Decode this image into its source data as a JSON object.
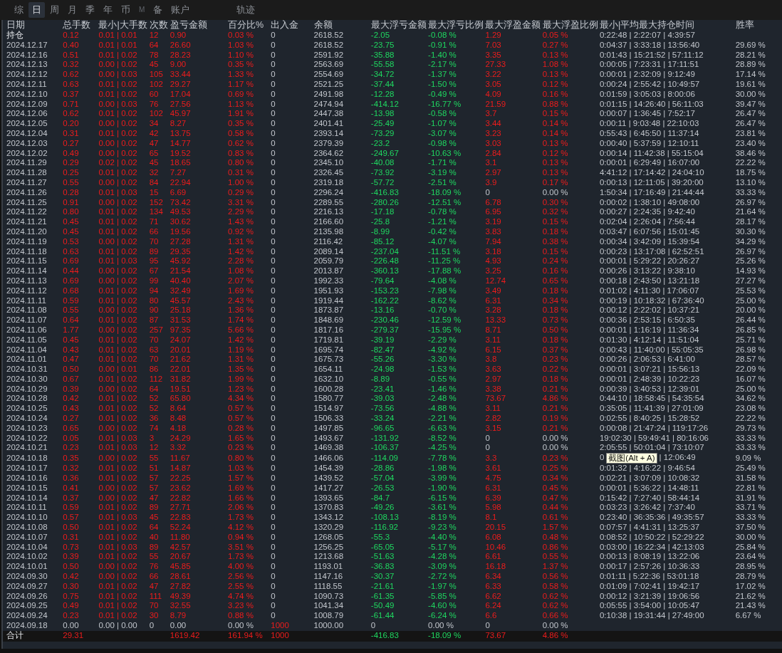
{
  "tabs": [
    {
      "label": "综",
      "selected": false,
      "kind": "normal"
    },
    {
      "label": "日",
      "selected": true,
      "kind": "normal"
    },
    {
      "label": "周",
      "selected": false,
      "kind": "normal"
    },
    {
      "label": "月",
      "selected": false,
      "kind": "normal"
    },
    {
      "label": "季",
      "selected": false,
      "kind": "normal"
    },
    {
      "label": "年",
      "selected": false,
      "kind": "normal"
    },
    {
      "label": "币",
      "selected": false,
      "kind": "normal"
    },
    {
      "label": "M",
      "selected": false,
      "kind": "dim"
    },
    {
      "label": "备",
      "selected": false,
      "kind": "normal"
    },
    {
      "label": "账户",
      "selected": false,
      "kind": "normal"
    },
    {
      "label": "轨迹",
      "selected": false,
      "kind": "far"
    }
  ],
  "table": {
    "columns": [
      "日期",
      "总手数",
      "最小|大手数",
      "次数",
      "盈亏金额",
      "百分比%",
      "出入金",
      "余额",
      "最大浮亏金额",
      "最大浮亏比例",
      "最大浮盈金额",
      "最大浮盈比例",
      "最小|平均最大持仓时间",
      "胜率"
    ],
    "rows": [
      {
        "kind": "position",
        "cells": [
          "持仓",
          "0.12",
          "0.01 | 0.01",
          "12",
          "0.90",
          "0.03 %",
          "0",
          "2618.52",
          "-2.05",
          "-0.08 %",
          "1.29",
          "0.05 %",
          "0:22:48 | 2:22:07 | 4:39:57"
        ]
      },
      {
        "kind": "day",
        "cells": [
          "2024.12.17",
          "0.40",
          "0.01 | 0.01",
          "64",
          "26.60",
          "1.03 %",
          "0",
          "2618.52",
          "-23.75",
          "-0.91 %",
          "7.03",
          "0.27 %",
          "0:04:37 | 3:33:18 | 13:56:40",
          "29.69 %"
        ]
      },
      {
        "kind": "day",
        "cells": [
          "2024.12.16",
          "0.51",
          "0.01 | 0.02",
          "78",
          "28.23",
          "1.10 %",
          "0",
          "2591.92",
          "-35.88",
          "-1.40 %",
          "3.35",
          "0.13 %",
          "0:01:43 | 15:21:52 | 57:11:12",
          "28.21 %"
        ]
      },
      {
        "kind": "day",
        "cells": [
          "2024.12.13",
          "0.32",
          "0.00 | 0.02",
          "45",
          "9.00",
          "0.35 %",
          "0",
          "2563.69",
          "-55.58",
          "-2.17 %",
          "27.33",
          "1.08 %",
          "0:00:05 | 7:23:31 | 17:11:51",
          "28.89 %"
        ]
      },
      {
        "kind": "day",
        "cells": [
          "2024.12.12",
          "0.62",
          "0.00 | 0.03",
          "105",
          "33.44",
          "1.33 %",
          "0",
          "2554.69",
          "-34.72",
          "-1.37 %",
          "3.22",
          "0.13 %",
          "0:00:01 | 2:32:09 | 9:12:49",
          "17.14 %"
        ]
      },
      {
        "kind": "day",
        "cells": [
          "2024.12.11",
          "0.63",
          "0.01 | 0.02",
          "102",
          "29.27",
          "1.17 %",
          "0",
          "2521.25",
          "-37.44",
          "-1.50 %",
          "3.05",
          "0.12 %",
          "0:00:24 | 2:55:42 | 10:49:57",
          "19.61 %"
        ]
      },
      {
        "kind": "day",
        "cells": [
          "2024.12.10",
          "0.37",
          "0.01 | 0.02",
          "60",
          "17.04",
          "0.69 %",
          "0",
          "2491.98",
          "-12.28",
          "-0.49 %",
          "4.09",
          "0.16 %",
          "0:01:59 | 3:05:03 | 8:00:06",
          "30.00 %"
        ]
      },
      {
        "kind": "day",
        "cells": [
          "2024.12.09",
          "0.71",
          "0.00 | 0.03",
          "76",
          "27.56",
          "1.13 %",
          "0",
          "2474.94",
          "-414.12",
          "-16.77 %",
          "21.59",
          "0.88 %",
          "0:01:15 | 14:26:40 | 56:11:03",
          "39.47 %"
        ]
      },
      {
        "kind": "day",
        "cells": [
          "2024.12.06",
          "0.62",
          "0.01 | 0.02",
          "102",
          "45.97",
          "1.91 %",
          "0",
          "2447.38",
          "-13.98",
          "-0.58 %",
          "3.7",
          "0.15 %",
          "0:00:07 | 1:36:45 | 7:52:17",
          "26.47 %"
        ]
      },
      {
        "kind": "day",
        "cells": [
          "2024.12.05",
          "0.20",
          "0.00 | 0.02",
          "34",
          "8.27",
          "0.35 %",
          "0",
          "2401.41",
          "-25.49",
          "-1.07 %",
          "3.44",
          "0.14 %",
          "0:00:11 | 9:03:48 | 22:10:03",
          "26.47 %"
        ]
      },
      {
        "kind": "day",
        "cells": [
          "2024.12.04",
          "0.31",
          "0.01 | 0.02",
          "42",
          "13.75",
          "0.58 %",
          "0",
          "2393.14",
          "-73.29",
          "-3.07 %",
          "3.23",
          "0.14 %",
          "0:55:43 | 6:45:50 | 11:37:14",
          "23.81 %"
        ]
      },
      {
        "kind": "day",
        "cells": [
          "2024.12.03",
          "0.27",
          "0.00 | 0.02",
          "47",
          "14.77",
          "0.62 %",
          "0",
          "2379.39",
          "-23.2",
          "-0.98 %",
          "3.03",
          "0.13 %",
          "0:00:40 | 5:37:59 | 12:10:11",
          "23.40 %"
        ]
      },
      {
        "kind": "day",
        "cells": [
          "2024.12.02",
          "0.49",
          "0.00 | 0.02",
          "65",
          "19.52",
          "0.83 %",
          "0",
          "2364.62",
          "-249.67",
          "-10.63 %",
          "2.84",
          "0.12 %",
          "0:00:14 | 11:42:38 | 55:15:04",
          "38.46 %"
        ]
      },
      {
        "kind": "day",
        "cells": [
          "2024.11.29",
          "0.29",
          "0.02 | 0.02",
          "45",
          "18.65",
          "0.80 %",
          "0",
          "2345.10",
          "-40.08",
          "-1.71 %",
          "3.1",
          "0.13 %",
          "0:00:01 | 6:29:49 | 16:07:00",
          "22.22 %"
        ]
      },
      {
        "kind": "day",
        "cells": [
          "2024.11.28",
          "0.25",
          "0.01 | 0.02",
          "32",
          "7.27",
          "0.31 %",
          "0",
          "2326.45",
          "-73.92",
          "-3.19 %",
          "2.97",
          "0.13 %",
          "4:41:12 | 17:14:42 | 24:04:10",
          "18.75 %"
        ]
      },
      {
        "kind": "day",
        "cells": [
          "2024.11.27",
          "0.55",
          "0.00 | 0.02",
          "84",
          "22.94",
          "1.00 %",
          "0",
          "2319.18",
          "-57.72",
          "-2.51 %",
          "3.9",
          "0.17 %",
          "0:00:13 | 12:11:05 | 39:20:00",
          "13.10 %"
        ]
      },
      {
        "kind": "flat_day",
        "cells": [
          "2024.11.26",
          "0.28",
          "0.01 | 0.03",
          "15",
          "6.69",
          "0.29 %",
          "0",
          "2296.24",
          "-416.83",
          "-18.09 %",
          "0",
          "0.00 %",
          "1:50:34 | 17:16:49 | 21:44:44",
          "33.33 %"
        ]
      },
      {
        "kind": "day",
        "cells": [
          "2024.11.25",
          "0.91",
          "0.00 | 0.02",
          "152",
          "73.42",
          "3.31 %",
          "0",
          "2289.55",
          "-280.26",
          "-12.51 %",
          "6.78",
          "0.30 %",
          "0:00:02 | 1:38:10 | 49:08:00",
          "26.97 %"
        ]
      },
      {
        "kind": "day",
        "cells": [
          "2024.11.22",
          "0.80",
          "0.01 | 0.02",
          "134",
          "49.53",
          "2.29 %",
          "0",
          "2216.13",
          "-17.18",
          "-0.78 %",
          "6.95",
          "0.32 %",
          "0:00:27 | 2:24:35 | 9:42:40",
          "21.64 %"
        ]
      },
      {
        "kind": "day",
        "cells": [
          "2024.11.21",
          "0.45",
          "0.01 | 0.02",
          "71",
          "30.62",
          "1.43 %",
          "0",
          "2166.60",
          "-25.8",
          "-1.21 %",
          "3.19",
          "0.15 %",
          "0:02:04 | 2:26:04 | 7:56:44",
          "28.17 %"
        ]
      },
      {
        "kind": "day",
        "cells": [
          "2024.11.20",
          "0.45",
          "0.01 | 0.02",
          "66",
          "19.56",
          "0.92 %",
          "0",
          "2135.98",
          "-8.99",
          "-0.42 %",
          "3.83",
          "0.18 %",
          "0:03:47 | 6:07:56 | 15:01:45",
          "30.30 %"
        ]
      },
      {
        "kind": "day",
        "cells": [
          "2024.11.19",
          "0.53",
          "0.00 | 0.02",
          "70",
          "27.28",
          "1.31 %",
          "0",
          "2116.42",
          "-85.12",
          "-4.07 %",
          "7.94",
          "0.38 %",
          "0:00:34 | 3:42:09 | 15:39:54",
          "34.29 %"
        ]
      },
      {
        "kind": "day",
        "cells": [
          "2024.11.18",
          "0.63",
          "0.01 | 0.02",
          "89",
          "29.35",
          "1.42 %",
          "0",
          "2089.14",
          "-237.04",
          "-11.51 %",
          "3.18",
          "0.15 %",
          "0:00:23 | 13:17:08 | 62:52:51",
          "26.97 %"
        ]
      },
      {
        "kind": "day",
        "cells": [
          "2024.11.15",
          "0.69",
          "0.01 | 0.03",
          "95",
          "45.92",
          "2.28 %",
          "0",
          "2059.79",
          "-226.48",
          "-11.25 %",
          "4.93",
          "0.24 %",
          "0:00:01 | 5:29:22 | 20:26:27",
          "25.26 %"
        ]
      },
      {
        "kind": "day",
        "cells": [
          "2024.11.14",
          "0.44",
          "0.00 | 0.02",
          "67",
          "21.54",
          "1.08 %",
          "0",
          "2013.87",
          "-360.13",
          "-17.88 %",
          "3.25",
          "0.16 %",
          "0:00:26 | 3:13:22 | 9:38:10",
          "14.93 %"
        ]
      },
      {
        "kind": "day",
        "cells": [
          "2024.11.13",
          "0.69",
          "0.00 | 0.02",
          "99",
          "40.40",
          "2.07 %",
          "0",
          "1992.33",
          "-79.64",
          "-4.08 %",
          "12.74",
          "0.65 %",
          "0:00:18 | 2:43:50 | 13:21:18",
          "27.27 %"
        ]
      },
      {
        "kind": "day",
        "cells": [
          "2024.11.12",
          "0.68",
          "0.01 | 0.02",
          "94",
          "32.49",
          "1.69 %",
          "0",
          "1951.93",
          "-153.23",
          "-7.98 %",
          "3.49",
          "0.18 %",
          "0:01:02 | 4:11:30 | 17:06:07",
          "25.53 %"
        ]
      },
      {
        "kind": "day",
        "cells": [
          "2024.11.11",
          "0.59",
          "0.01 | 0.02",
          "80",
          "45.57",
          "2.43 %",
          "0",
          "1919.44",
          "-162.22",
          "-8.62 %",
          "6.31",
          "0.34 %",
          "0:00:19 | 10:18:32 | 67:36:40",
          "25.00 %"
        ]
      },
      {
        "kind": "day",
        "cells": [
          "2024.11.08",
          "0.55",
          "0.00 | 0.02",
          "90",
          "25.18",
          "1.36 %",
          "0",
          "1873.87",
          "-13.16",
          "-0.70 %",
          "3.28",
          "0.18 %",
          "0:00:12 | 2:22:02 | 10:37:21",
          "20.00 %"
        ]
      },
      {
        "kind": "day",
        "cells": [
          "2024.11.07",
          "0.64",
          "0.01 | 0.02",
          "87",
          "31.53",
          "1.74 %",
          "0",
          "1848.69",
          "-230.46",
          "-12.59 %",
          "13.33",
          "0.73 %",
          "0:00:36 | 2:53:15 | 6:50:35",
          "26.44 %"
        ]
      },
      {
        "kind": "day",
        "cells": [
          "2024.11.06",
          "1.77",
          "0.00 | 0.02",
          "257",
          "97.35",
          "5.66 %",
          "0",
          "1817.16",
          "-279.37",
          "-15.95 %",
          "8.71",
          "0.50 %",
          "0:00:01 | 1:16:19 | 11:36:34",
          "26.85 %"
        ]
      },
      {
        "kind": "day",
        "cells": [
          "2024.11.05",
          "0.45",
          "0.01 | 0.02",
          "70",
          "24.07",
          "1.42 %",
          "0",
          "1719.81",
          "-39.19",
          "-2.29 %",
          "3.11",
          "0.18 %",
          "0:01:30 | 4:12:14 | 11:51:04",
          "25.71 %"
        ]
      },
      {
        "kind": "day",
        "cells": [
          "2024.11.04",
          "0.43",
          "0.01 | 0.02",
          "63",
          "20.01",
          "1.19 %",
          "0",
          "1695.74",
          "-82.47",
          "-4.92 %",
          "6.15",
          "0.37 %",
          "0:00:43 | 11:40:00 | 55:05:35",
          "26.98 %"
        ]
      },
      {
        "kind": "day",
        "cells": [
          "2024.11.01",
          "0.47",
          "0.01 | 0.02",
          "70",
          "21.62",
          "1.31 %",
          "0",
          "1675.73",
          "-55.26",
          "-3.30 %",
          "3.8",
          "0.23 %",
          "0:00:26 | 2:06:53 | 6:41:00",
          "28.57 %"
        ]
      },
      {
        "kind": "day",
        "cells": [
          "2024.10.31",
          "0.50",
          "0.00 | 0.01",
          "86",
          "22.01",
          "1.35 %",
          "0",
          "1654.11",
          "-24.98",
          "-1.53 %",
          "3.63",
          "0.22 %",
          "0:00:01 | 3:07:21 | 15:56:13",
          "22.09 %"
        ]
      },
      {
        "kind": "day",
        "cells": [
          "2024.10.30",
          "0.67",
          "0.01 | 0.02",
          "112",
          "31.82",
          "1.99 %",
          "0",
          "1632.10",
          "-8.89",
          "-0.55 %",
          "2.97",
          "0.18 %",
          "0:00:01 | 2:48:39 | 10:22:23",
          "16.07 %"
        ]
      },
      {
        "kind": "day",
        "cells": [
          "2024.10.29",
          "0.39",
          "0.00 | 0.02",
          "64",
          "19.51",
          "1.23 %",
          "0",
          "1600.28",
          "-23.41",
          "-1.46 %",
          "3.38",
          "0.21 %",
          "0:00:39 | 3:40:53 | 12:39:01",
          "25.00 %"
        ]
      },
      {
        "kind": "day",
        "cells": [
          "2024.10.28",
          "0.42",
          "0.01 | 0.02",
          "52",
          "65.80",
          "4.34 %",
          "0",
          "1580.77",
          "-39.03",
          "-2.48 %",
          "73.67",
          "4.86 %",
          "0:44:10 | 18:58:45 | 54:35:54",
          "34.62 %"
        ]
      },
      {
        "kind": "day",
        "cells": [
          "2024.10.25",
          "0.43",
          "0.01 | 0.02",
          "52",
          "8.64",
          "0.57 %",
          "0",
          "1514.97",
          "-73.56",
          "-4.88 %",
          "3.11",
          "0.21 %",
          "0:35:05 | 11:41:39 | 27:01:09",
          "23.08 %"
        ]
      },
      {
        "kind": "day",
        "cells": [
          "2024.10.24",
          "0.27",
          "0.01 | 0.02",
          "36",
          "8.48",
          "0.57 %",
          "0",
          "1506.33",
          "-33.24",
          "-2.21 %",
          "2.82",
          "0.19 %",
          "0:02:55 | 8:40:25 | 15:28:52",
          "22.22 %"
        ]
      },
      {
        "kind": "day",
        "cells": [
          "2024.10.23",
          "0.65",
          "0.00 | 0.02",
          "74",
          "4.18",
          "0.28 %",
          "0",
          "1497.85",
          "-96.65",
          "-6.63 %",
          "3.15",
          "0.21 %",
          "0:00:08 | 21:47:24 | 119:17:26",
          "29.73 %"
        ]
      },
      {
        "kind": "flat_day",
        "cells": [
          "2024.10.22",
          "0.05",
          "0.01 | 0.03",
          "3",
          "24.29",
          "1.65 %",
          "0",
          "1493.67",
          "-131.92",
          "-8.52 %",
          "0",
          "0.00 %",
          "19:02:30 | 59:49:41 | 80:16:06",
          "33.33 %"
        ]
      },
      {
        "kind": "flat_day",
        "cells": [
          "2024.10.21",
          "0.23",
          "0.01 | 0.03",
          "12",
          "3.32",
          "0.23 %",
          "0",
          "1469.38",
          "-106.37",
          "-4.25 %",
          "0",
          "0.00 %",
          "2:05:55 | 50:01:04 | 73:10:07",
          "33.33 %"
        ]
      },
      {
        "kind": "day",
        "cells": [
          "2024.10.18",
          "0.35",
          "0.00 | 0.02",
          "55",
          "11.67",
          "0.80 %",
          "0",
          "1466.06",
          "-114.09",
          "-7.78 %",
          "3.3",
          "0.23 %",
          "0",
          "9.09 %"
        ],
        "tooltip": "截图(Alt + A)",
        "time_rest": "| 12:06:49"
      },
      {
        "kind": "day",
        "cells": [
          "2024.10.17",
          "0.32",
          "0.01 | 0.02",
          "51",
          "14.87",
          "1.03 %",
          "0",
          "1454.39",
          "-28.86",
          "-1.98 %",
          "3.61",
          "0.25 %",
          "0:01:32 | 4:16:22 | 9:46:54",
          "25.49 %"
        ]
      },
      {
        "kind": "day",
        "cells": [
          "2024.10.16",
          "0.36",
          "0.01 | 0.02",
          "57",
          "22.25",
          "1.57 %",
          "0",
          "1439.52",
          "-57.04",
          "-3.99 %",
          "4.75",
          "0.34 %",
          "0:02:21 | 3:07:09 | 10:08:32",
          "31.58 %"
        ]
      },
      {
        "kind": "day",
        "cells": [
          "2024.10.15",
          "0.41",
          "0.00 | 0.02",
          "57",
          "23.62",
          "1.69 %",
          "0",
          "1417.27",
          "-26.53",
          "-1.90 %",
          "6.31",
          "0.45 %",
          "0:00:01 | 5:36:22 | 14:48:11",
          "22.81 %"
        ]
      },
      {
        "kind": "day",
        "cells": [
          "2024.10.14",
          "0.37",
          "0.00 | 0.02",
          "47",
          "22.82",
          "1.66 %",
          "0",
          "1393.65",
          "-84.7",
          "-6.15 %",
          "6.39",
          "0.47 %",
          "0:15:42 | 7:27:40 | 58:44:14",
          "31.91 %"
        ]
      },
      {
        "kind": "day",
        "cells": [
          "2024.10.11",
          "0.59",
          "0.01 | 0.02",
          "89",
          "27.71",
          "2.06 %",
          "0",
          "1370.83",
          "-49.26",
          "-3.61 %",
          "5.98",
          "0.44 %",
          "0:03:23 | 3:26:42 | 7:37:40",
          "33.71 %"
        ]
      },
      {
        "kind": "day",
        "cells": [
          "2024.10.10",
          "0.57",
          "0.01 | 0.03",
          "45",
          "22.83",
          "1.73 %",
          "0",
          "1343.12",
          "-108.13",
          "-8.19 %",
          "8.1",
          "0.61 %",
          "0:23:40 | 36:35:36 | 49:35:57",
          "33.33 %"
        ]
      },
      {
        "kind": "day",
        "cells": [
          "2024.10.08",
          "0.50",
          "0.01 | 0.02",
          "64",
          "52.24",
          "4.12 %",
          "0",
          "1320.29",
          "-116.92",
          "-9.23 %",
          "20.15",
          "1.57 %",
          "0:07:57 | 4:41:31 | 13:25:37",
          "37.50 %"
        ]
      },
      {
        "kind": "day",
        "cells": [
          "2024.10.07",
          "0.31",
          "0.01 | 0.02",
          "40",
          "11.80",
          "0.94 %",
          "0",
          "1268.05",
          "-55.3",
          "-4.40 %",
          "6.08",
          "0.48 %",
          "0:08:52 | 10:50:22 | 52:29:22",
          "30.00 %"
        ]
      },
      {
        "kind": "day",
        "cells": [
          "2024.10.04",
          "0.73",
          "0.01 | 0.03",
          "89",
          "42.57",
          "3.51 %",
          "0",
          "1256.25",
          "-65.05",
          "-5.17 %",
          "10.46",
          "0.86 %",
          "0:03:00 | 16:22:34 | 42:13:03",
          "25.84 %"
        ]
      },
      {
        "kind": "day",
        "cells": [
          "2024.10.02",
          "0.39",
          "0.01 | 0.02",
          "55",
          "20.67",
          "1.73 %",
          "0",
          "1213.68",
          "-51.63",
          "-4.28 %",
          "6.61",
          "0.55 %",
          "0:00:13 | 8:08:19 | 13:22:06",
          "23.64 %"
        ]
      },
      {
        "kind": "day",
        "cells": [
          "2024.10.01",
          "0.50",
          "0.00 | 0.02",
          "76",
          "45.85",
          "4.00 %",
          "0",
          "1193.01",
          "-36.83",
          "-3.09 %",
          "16.18",
          "1.37 %",
          "0:00:17 | 2:57:26 | 10:36:33",
          "28.95 %"
        ]
      },
      {
        "kind": "day",
        "cells": [
          "2024.09.30",
          "0.42",
          "0.00 | 0.02",
          "66",
          "28.61",
          "2.56 %",
          "0",
          "1147.16",
          "-30.37",
          "-2.72 %",
          "6.34",
          "0.56 %",
          "0:01:11 | 5:22:36 | 53:01:18",
          "28.79 %"
        ]
      },
      {
        "kind": "day",
        "cells": [
          "2024.09.27",
          "0.30",
          "0.01 | 0.02",
          "47",
          "27.82",
          "2.55 %",
          "0",
          "1118.55",
          "-21.61",
          "-1.97 %",
          "6.33",
          "0.58 %",
          "0:01:09 | 7:02:41 | 19:42:17",
          "17.02 %"
        ]
      },
      {
        "kind": "day",
        "cells": [
          "2024.09.26",
          "0.75",
          "0.01 | 0.02",
          "111",
          "49.39",
          "4.74 %",
          "0",
          "1090.73",
          "-61.35",
          "-5.85 %",
          "6.62",
          "0.62 %",
          "0:00:12 | 3:21:39 | 19:06:56",
          "21.62 %"
        ]
      },
      {
        "kind": "day",
        "cells": [
          "2024.09.25",
          "0.49",
          "0.01 | 0.02",
          "70",
          "32.55",
          "3.23 %",
          "0",
          "1041.34",
          "-50.49",
          "-4.60 %",
          "6.24",
          "0.62 %",
          "0:05:55 | 3:54:00 | 10:05:47",
          "21.43 %"
        ]
      },
      {
        "kind": "day",
        "cells": [
          "2024.09.24",
          "0.23",
          "0.01 | 0.02",
          "30",
          "8.79",
          "0.88 %",
          "0",
          "1008.79",
          "-61.44",
          "-6.24 %",
          "6.6",
          "0.66 %",
          "0:10:38 | 19:31:44 | 27:49:00",
          "6.67 %"
        ]
      },
      {
        "kind": "deposit",
        "cells": [
          "2024.09.18",
          "0.00",
          "0.00 | 0.00",
          "0",
          "0.00",
          "0.00 %",
          "1000",
          "1000.00",
          "0",
          "0.00 %",
          "0",
          "0.00 %"
        ]
      },
      {
        "kind": "total",
        "cells": [
          "合计",
          "29.31",
          null,
          null,
          "1619.42",
          "161.94 %",
          "1000",
          null,
          "-416.83",
          "-18.09 %",
          "73.67",
          "4.86 %"
        ]
      }
    ]
  }
}
